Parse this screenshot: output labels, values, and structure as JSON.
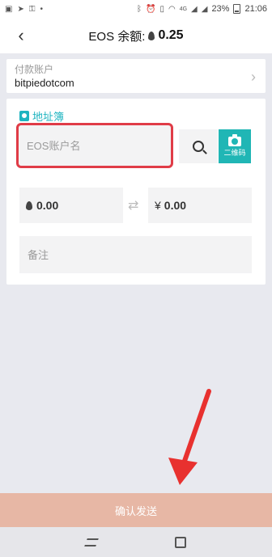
{
  "status_bar": {
    "battery": "23%",
    "time": "21:06",
    "network": "4G"
  },
  "header": {
    "title_prefix": "EOS 余额:",
    "balance": "0.25"
  },
  "pay_account": {
    "label": "付款账户",
    "value": "bitpiedotcom"
  },
  "form": {
    "address_book_label": "地址簿",
    "account_placeholder": "EOS账户名",
    "qr_label": "二维码",
    "eos_amount": "0.00",
    "cny_symbol": "¥",
    "cny_amount": "0.00",
    "memo_placeholder": "备注"
  },
  "confirm_button": {
    "label": "确认发送"
  },
  "colors": {
    "accent": "#20b6b5",
    "highlight_border": "#e03c47",
    "confirm_bg": "#e7b7a5",
    "arrow": "#e8312f"
  }
}
